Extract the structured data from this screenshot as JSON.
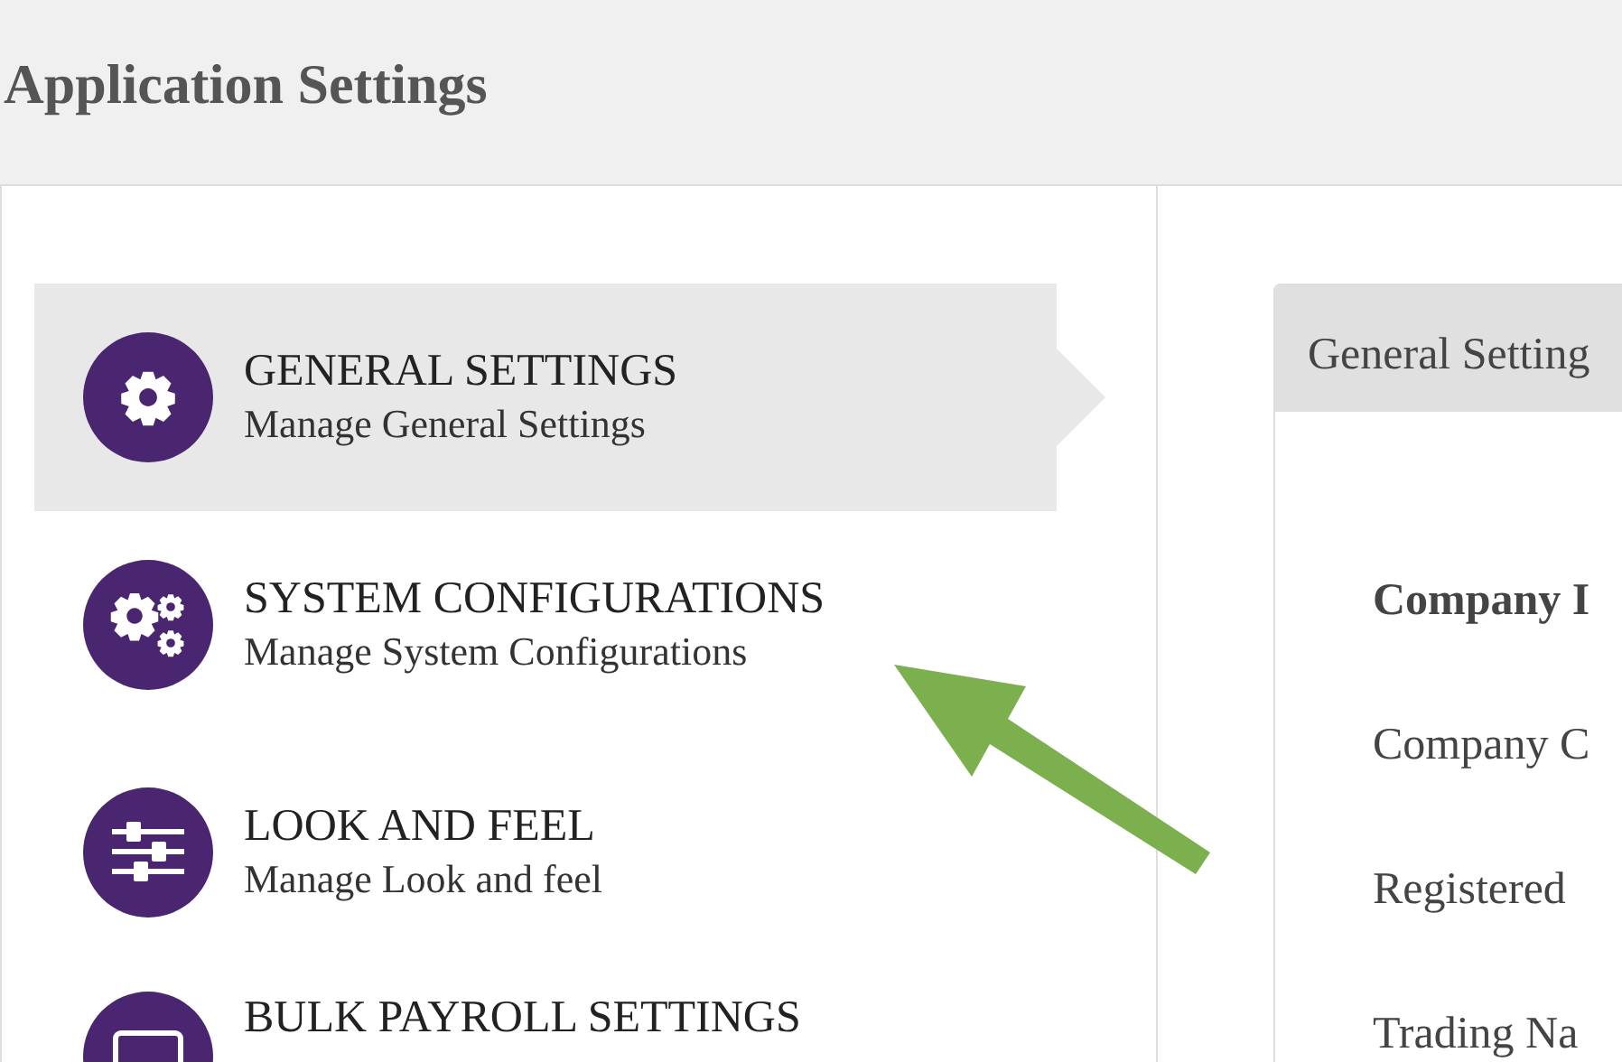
{
  "page_title": "Application Settings",
  "menu": [
    {
      "kind": "general",
      "title": "GENERAL SETTINGS",
      "subtitle": "Manage General Settings",
      "selected": true
    },
    {
      "kind": "system",
      "title": "SYSTEM CONFIGURATIONS",
      "subtitle": "Manage System Configurations",
      "selected": false
    },
    {
      "kind": "look",
      "title": "LOOK AND FEEL",
      "subtitle": "Manage Look and feel",
      "selected": false
    },
    {
      "kind": "payroll",
      "title": "BULK PAYROLL SETTINGS",
      "selected": false
    }
  ],
  "panel": {
    "title": "General Setting",
    "fields": [
      {
        "label": "Company I",
        "bold": true
      },
      {
        "label": "Company C",
        "bold": false
      },
      {
        "label": "Registered",
        "bold": false
      },
      {
        "label": "Trading Na",
        "bold": false
      }
    ]
  }
}
